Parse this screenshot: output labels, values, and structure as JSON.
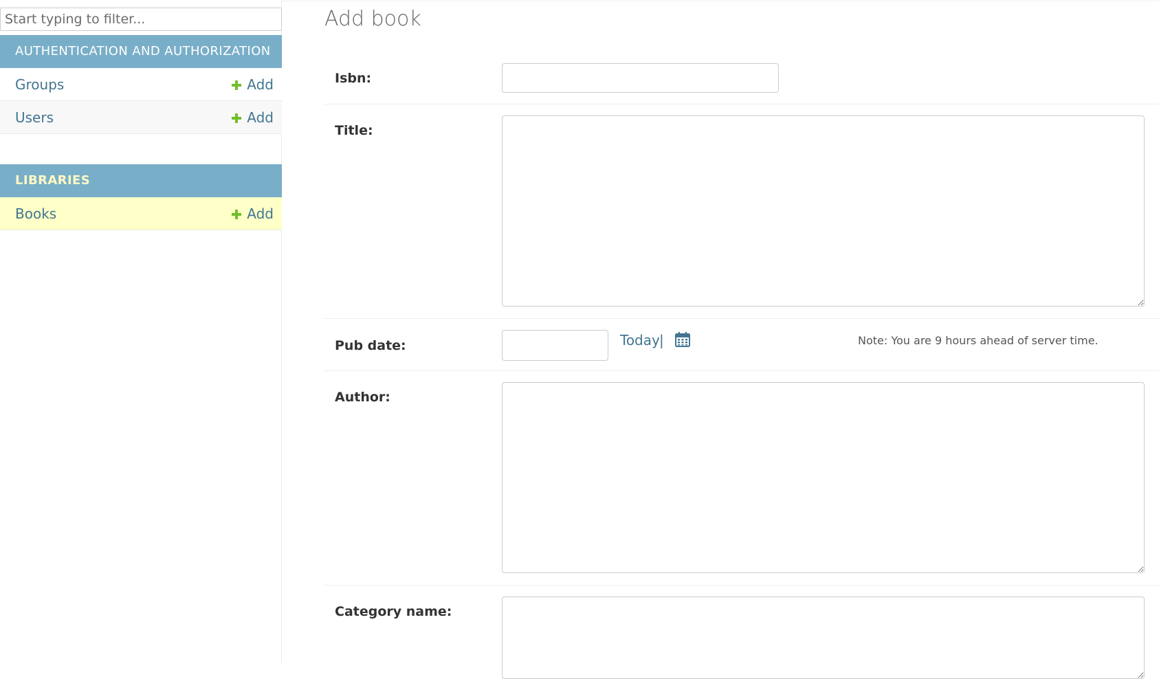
{
  "sidebar": {
    "filter_placeholder": "Start typing to filter...",
    "modules": [
      {
        "caption": "Authentication and Authorization",
        "models": [
          {
            "name": "Groups",
            "add_label": "Add"
          },
          {
            "name": "Users",
            "add_label": "Add"
          }
        ]
      },
      {
        "caption": "Libraries",
        "models": [
          {
            "name": "Books",
            "add_label": "Add"
          }
        ]
      }
    ]
  },
  "main": {
    "title": "Add book",
    "fields": {
      "isbn": {
        "label": "Isbn:",
        "value": ""
      },
      "title": {
        "label": "Title:",
        "value": ""
      },
      "pub_date": {
        "label": "Pub date:",
        "value": "",
        "today_label": "Today",
        "separator": "|",
        "calendar_icon": "calendar-icon",
        "note": "Note: You are 9 hours ahead of server time."
      },
      "author": {
        "label": "Author:",
        "value": ""
      },
      "category_name": {
        "label": "Category name:",
        "value": ""
      }
    }
  },
  "colors": {
    "module_header": "#79aec8",
    "current_module_text": "#fff9c4",
    "link": "#417690",
    "add_icon": "#70bf2b",
    "selected_row": "#ffffc8"
  }
}
